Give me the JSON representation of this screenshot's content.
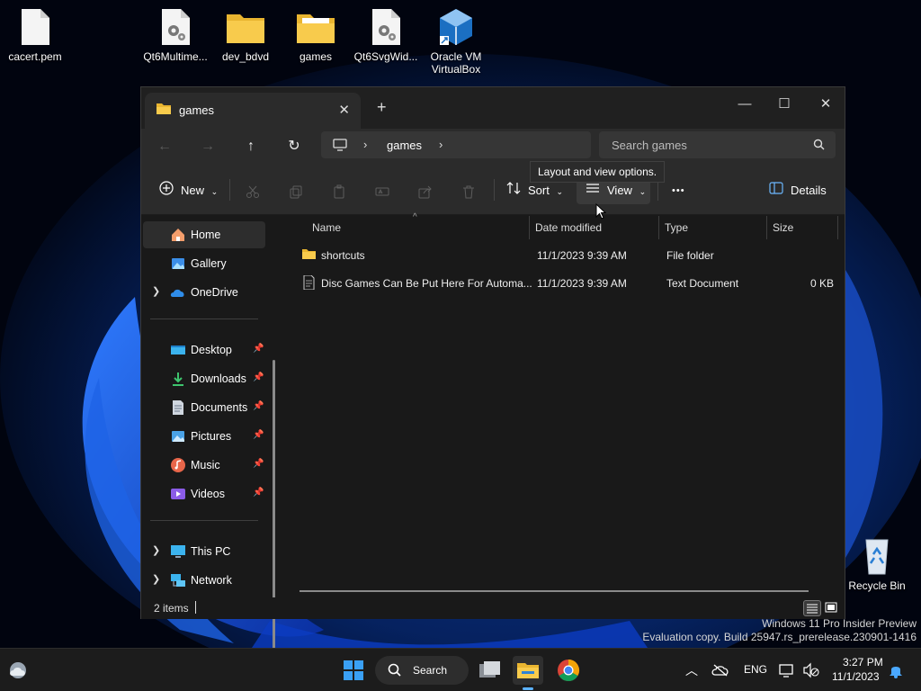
{
  "desktop": {
    "icons": [
      {
        "label": "cacert.pem"
      },
      {
        "label": "Qt6Multime..."
      },
      {
        "label": "dev_bdvd"
      },
      {
        "label": "games"
      },
      {
        "label": "Qt6SvgWid..."
      },
      {
        "label": "Oracle VM VirtualBox"
      },
      {
        "label": "Recycle Bin"
      }
    ]
  },
  "explorer": {
    "tab_title": "games",
    "tab_close": "✕",
    "new_tab": "+",
    "window_controls": {
      "minimize": "—",
      "maximize": "☐",
      "close": "✕"
    },
    "nav": {
      "back": "←",
      "forward": "→",
      "up": "↑",
      "refresh": "↻"
    },
    "address": {
      "chevron": "›",
      "crumb": "games"
    },
    "search_placeholder": "Search games",
    "toolbar": {
      "new_label": "New",
      "sort_label": "Sort",
      "view_label": "View",
      "more_label": "•••",
      "details_label": "Details",
      "tooltip": "Layout and view options."
    },
    "sidebar": {
      "items": [
        {
          "label": "Home"
        },
        {
          "label": "Gallery"
        },
        {
          "label": "OneDrive"
        },
        {
          "label": "Desktop"
        },
        {
          "label": "Downloads"
        },
        {
          "label": "Documents"
        },
        {
          "label": "Pictures"
        },
        {
          "label": "Music"
        },
        {
          "label": "Videos"
        },
        {
          "label": "This PC"
        },
        {
          "label": "Network"
        }
      ]
    },
    "columns": [
      "Name",
      "Date modified",
      "Type",
      "Size"
    ],
    "files": [
      {
        "name": "shortcuts",
        "modified": "11/1/2023 9:39 AM",
        "type": "File folder",
        "size": ""
      },
      {
        "name": "Disc Games Can Be Put Here For Automa...",
        "modified": "11/1/2023 9:39 AM",
        "type": "Text Document",
        "size": "0 KB"
      }
    ],
    "status": "2 items"
  },
  "watermark": {
    "line1": "Windows 11 Pro Insider Preview",
    "line2": "Evaluation copy. Build 25947.rs_prerelease.230901-1416"
  },
  "taskbar": {
    "search_label": "Search",
    "language": "ENG",
    "time": "3:27 PM",
    "date": "11/1/2023"
  },
  "colors": {
    "accent_blue": "#0067c0",
    "folder_yellow": "#f6c443",
    "window_bg": "#191919"
  }
}
